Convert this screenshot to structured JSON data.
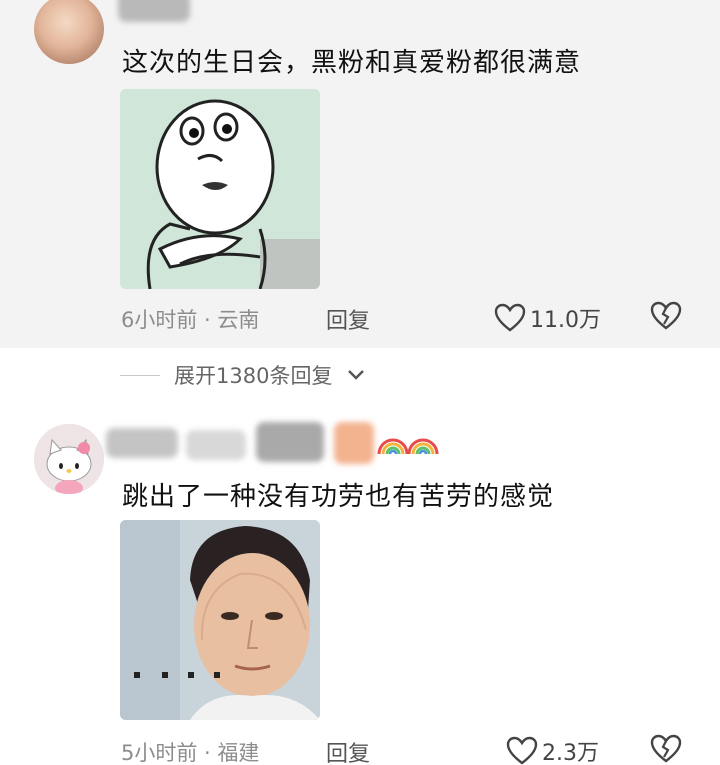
{
  "comments": [
    {
      "text": "这次的生日会，黑粉和真爱粉都很满意",
      "meta": "6小时前 · 云南",
      "reply_label": "回复",
      "likes": "11.0万"
    },
    {
      "text": "跳出了一种没有功劳也有苦劳的感觉",
      "meta": "5小时前 · 福建",
      "reply_label": "回复",
      "likes": "2.3万"
    }
  ],
  "expand_replies": "展开1380条回复",
  "icons": [
    "heart-icon",
    "broken-heart-icon",
    "chevron-down-icon",
    "rainbow-icon"
  ],
  "colors": {
    "comment_highlight_bg": "#f3f3f3",
    "meta_text": "#8d8d8d"
  }
}
